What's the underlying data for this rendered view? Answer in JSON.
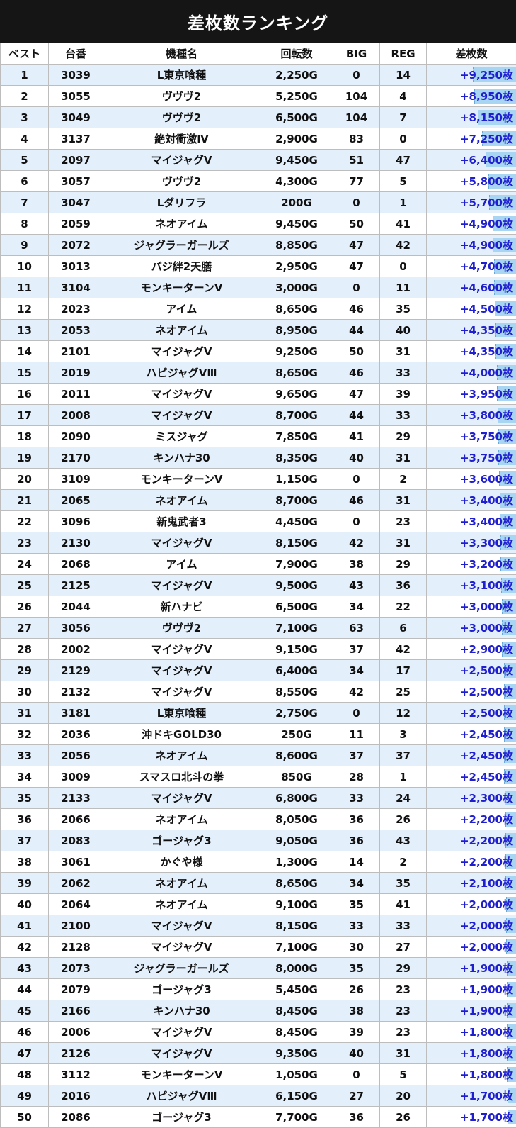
{
  "title": "差枚数ランキング",
  "columns": [
    "ベスト",
    "台番",
    "機種名",
    "回転数",
    "BIG",
    "REG",
    "差枚数"
  ],
  "colors": {
    "header_bg": "#151515",
    "row_alt": "#e3effb",
    "bar": "#a8d6f2",
    "diff_text": "#1f1fcf"
  },
  "chart_data": {
    "type": "table",
    "title": "差枚数ランキング",
    "columns": [
      "ベスト",
      "台番",
      "機種名",
      "回転数",
      "BIG",
      "REG",
      "差枚数"
    ],
    "bar_max": 9250,
    "rows": [
      {
        "rank": "1",
        "machine_no": "3039",
        "name": "L東京喰種",
        "spins": "2,250G",
        "big": "0",
        "reg": "14",
        "diff": "+9,250枚",
        "diff_value": 9250
      },
      {
        "rank": "2",
        "machine_no": "3055",
        "name": "ヴヴヴ2",
        "spins": "5,250G",
        "big": "104",
        "reg": "4",
        "diff": "+8,950枚",
        "diff_value": 8950
      },
      {
        "rank": "3",
        "machine_no": "3049",
        "name": "ヴヴヴ2",
        "spins": "6,500G",
        "big": "104",
        "reg": "7",
        "diff": "+8,150枚",
        "diff_value": 8150
      },
      {
        "rank": "4",
        "machine_no": "3137",
        "name": "絶対衝激Ⅳ",
        "spins": "2,900G",
        "big": "83",
        "reg": "0",
        "diff": "+7,250枚",
        "diff_value": 7250
      },
      {
        "rank": "5",
        "machine_no": "2097",
        "name": "マイジャグV",
        "spins": "9,450G",
        "big": "51",
        "reg": "47",
        "diff": "+6,400枚",
        "diff_value": 6400
      },
      {
        "rank": "6",
        "machine_no": "3057",
        "name": "ヴヴヴ2",
        "spins": "4,300G",
        "big": "77",
        "reg": "5",
        "diff": "+5,800枚",
        "diff_value": 5800
      },
      {
        "rank": "7",
        "machine_no": "3047",
        "name": "Lダリフラ",
        "spins": "200G",
        "big": "0",
        "reg": "1",
        "diff": "+5,700枚",
        "diff_value": 5700
      },
      {
        "rank": "8",
        "machine_no": "2059",
        "name": "ネオアイム",
        "spins": "9,450G",
        "big": "50",
        "reg": "41",
        "diff": "+4,900枚",
        "diff_value": 4900
      },
      {
        "rank": "9",
        "machine_no": "2072",
        "name": "ジャグラーガールズ",
        "spins": "8,850G",
        "big": "47",
        "reg": "42",
        "diff": "+4,900枚",
        "diff_value": 4900
      },
      {
        "rank": "10",
        "machine_no": "3013",
        "name": "バジ絆2天膳",
        "spins": "2,950G",
        "big": "47",
        "reg": "0",
        "diff": "+4,700枚",
        "diff_value": 4700
      },
      {
        "rank": "11",
        "machine_no": "3104",
        "name": "モンキーターンV",
        "spins": "3,000G",
        "big": "0",
        "reg": "11",
        "diff": "+4,600枚",
        "diff_value": 4600
      },
      {
        "rank": "12",
        "machine_no": "2023",
        "name": "アイム",
        "spins": "8,650G",
        "big": "46",
        "reg": "35",
        "diff": "+4,500枚",
        "diff_value": 4500
      },
      {
        "rank": "13",
        "machine_no": "2053",
        "name": "ネオアイム",
        "spins": "8,950G",
        "big": "44",
        "reg": "40",
        "diff": "+4,350枚",
        "diff_value": 4350
      },
      {
        "rank": "14",
        "machine_no": "2101",
        "name": "マイジャグV",
        "spins": "9,250G",
        "big": "50",
        "reg": "31",
        "diff": "+4,350枚",
        "diff_value": 4350
      },
      {
        "rank": "15",
        "machine_no": "2019",
        "name": "ハピジャグVⅢ",
        "spins": "8,650G",
        "big": "46",
        "reg": "33",
        "diff": "+4,000枚",
        "diff_value": 4000
      },
      {
        "rank": "16",
        "machine_no": "2011",
        "name": "マイジャグV",
        "spins": "9,650G",
        "big": "47",
        "reg": "39",
        "diff": "+3,950枚",
        "diff_value": 3950
      },
      {
        "rank": "17",
        "machine_no": "2008",
        "name": "マイジャグV",
        "spins": "8,700G",
        "big": "44",
        "reg": "33",
        "diff": "+3,800枚",
        "diff_value": 3800
      },
      {
        "rank": "18",
        "machine_no": "2090",
        "name": "ミスジャグ",
        "spins": "7,850G",
        "big": "41",
        "reg": "29",
        "diff": "+3,750枚",
        "diff_value": 3750
      },
      {
        "rank": "19",
        "machine_no": "2170",
        "name": "キンハナ30",
        "spins": "8,350G",
        "big": "40",
        "reg": "31",
        "diff": "+3,750枚",
        "diff_value": 3750
      },
      {
        "rank": "20",
        "machine_no": "3109",
        "name": "モンキーターンV",
        "spins": "1,150G",
        "big": "0",
        "reg": "2",
        "diff": "+3,600枚",
        "diff_value": 3600
      },
      {
        "rank": "21",
        "machine_no": "2065",
        "name": "ネオアイム",
        "spins": "8,700G",
        "big": "46",
        "reg": "31",
        "diff": "+3,400枚",
        "diff_value": 3400
      },
      {
        "rank": "22",
        "machine_no": "3096",
        "name": "新鬼武者3",
        "spins": "4,450G",
        "big": "0",
        "reg": "23",
        "diff": "+3,400枚",
        "diff_value": 3400
      },
      {
        "rank": "23",
        "machine_no": "2130",
        "name": "マイジャグV",
        "spins": "8,150G",
        "big": "42",
        "reg": "31",
        "diff": "+3,300枚",
        "diff_value": 3300
      },
      {
        "rank": "24",
        "machine_no": "2068",
        "name": "アイム",
        "spins": "7,900G",
        "big": "38",
        "reg": "29",
        "diff": "+3,200枚",
        "diff_value": 3200
      },
      {
        "rank": "25",
        "machine_no": "2125",
        "name": "マイジャグV",
        "spins": "9,500G",
        "big": "43",
        "reg": "36",
        "diff": "+3,100枚",
        "diff_value": 3100
      },
      {
        "rank": "26",
        "machine_no": "2044",
        "name": "新ハナビ",
        "spins": "6,500G",
        "big": "34",
        "reg": "22",
        "diff": "+3,000枚",
        "diff_value": 3000
      },
      {
        "rank": "27",
        "machine_no": "3056",
        "name": "ヴヴヴ2",
        "spins": "7,100G",
        "big": "63",
        "reg": "6",
        "diff": "+3,000枚",
        "diff_value": 3000
      },
      {
        "rank": "28",
        "machine_no": "2002",
        "name": "マイジャグV",
        "spins": "9,150G",
        "big": "37",
        "reg": "42",
        "diff": "+2,900枚",
        "diff_value": 2900
      },
      {
        "rank": "29",
        "machine_no": "2129",
        "name": "マイジャグV",
        "spins": "6,400G",
        "big": "34",
        "reg": "17",
        "diff": "+2,500枚",
        "diff_value": 2500
      },
      {
        "rank": "30",
        "machine_no": "2132",
        "name": "マイジャグV",
        "spins": "8,550G",
        "big": "42",
        "reg": "25",
        "diff": "+2,500枚",
        "diff_value": 2500
      },
      {
        "rank": "31",
        "machine_no": "3181",
        "name": "L東京喰種",
        "spins": "2,750G",
        "big": "0",
        "reg": "12",
        "diff": "+2,500枚",
        "diff_value": 2500
      },
      {
        "rank": "32",
        "machine_no": "2036",
        "name": "沖ドキGOLD30",
        "spins": "250G",
        "big": "11",
        "reg": "3",
        "diff": "+2,450枚",
        "diff_value": 2450
      },
      {
        "rank": "33",
        "machine_no": "2056",
        "name": "ネオアイム",
        "spins": "8,600G",
        "big": "37",
        "reg": "37",
        "diff": "+2,450枚",
        "diff_value": 2450
      },
      {
        "rank": "34",
        "machine_no": "3009",
        "name": "スマスロ北斗の拳",
        "spins": "850G",
        "big": "28",
        "reg": "1",
        "diff": "+2,450枚",
        "diff_value": 2450
      },
      {
        "rank": "35",
        "machine_no": "2133",
        "name": "マイジャグV",
        "spins": "6,800G",
        "big": "33",
        "reg": "24",
        "diff": "+2,300枚",
        "diff_value": 2300
      },
      {
        "rank": "36",
        "machine_no": "2066",
        "name": "ネオアイム",
        "spins": "8,050G",
        "big": "36",
        "reg": "26",
        "diff": "+2,200枚",
        "diff_value": 2200
      },
      {
        "rank": "37",
        "machine_no": "2083",
        "name": "ゴージャグ3",
        "spins": "9,050G",
        "big": "36",
        "reg": "43",
        "diff": "+2,200枚",
        "diff_value": 2200
      },
      {
        "rank": "38",
        "machine_no": "3061",
        "name": "かぐや様",
        "spins": "1,300G",
        "big": "14",
        "reg": "2",
        "diff": "+2,200枚",
        "diff_value": 2200
      },
      {
        "rank": "39",
        "machine_no": "2062",
        "name": "ネオアイム",
        "spins": "8,650G",
        "big": "34",
        "reg": "35",
        "diff": "+2,100枚",
        "diff_value": 2100
      },
      {
        "rank": "40",
        "machine_no": "2064",
        "name": "ネオアイム",
        "spins": "9,100G",
        "big": "35",
        "reg": "41",
        "diff": "+2,000枚",
        "diff_value": 2000
      },
      {
        "rank": "41",
        "machine_no": "2100",
        "name": "マイジャグV",
        "spins": "8,150G",
        "big": "33",
        "reg": "33",
        "diff": "+2,000枚",
        "diff_value": 2000
      },
      {
        "rank": "42",
        "machine_no": "2128",
        "name": "マイジャグV",
        "spins": "7,100G",
        "big": "30",
        "reg": "27",
        "diff": "+2,000枚",
        "diff_value": 2000
      },
      {
        "rank": "43",
        "machine_no": "2073",
        "name": "ジャグラーガールズ",
        "spins": "8,000G",
        "big": "35",
        "reg": "29",
        "diff": "+1,900枚",
        "diff_value": 1900
      },
      {
        "rank": "44",
        "machine_no": "2079",
        "name": "ゴージャグ3",
        "spins": "5,450G",
        "big": "26",
        "reg": "23",
        "diff": "+1,900枚",
        "diff_value": 1900
      },
      {
        "rank": "45",
        "machine_no": "2166",
        "name": "キンハナ30",
        "spins": "8,450G",
        "big": "38",
        "reg": "23",
        "diff": "+1,900枚",
        "diff_value": 1900
      },
      {
        "rank": "46",
        "machine_no": "2006",
        "name": "マイジャグV",
        "spins": "8,450G",
        "big": "39",
        "reg": "23",
        "diff": "+1,800枚",
        "diff_value": 1800
      },
      {
        "rank": "47",
        "machine_no": "2126",
        "name": "マイジャグV",
        "spins": "9,350G",
        "big": "40",
        "reg": "31",
        "diff": "+1,800枚",
        "diff_value": 1800
      },
      {
        "rank": "48",
        "machine_no": "3112",
        "name": "モンキーターンV",
        "spins": "1,050G",
        "big": "0",
        "reg": "5",
        "diff": "+1,800枚",
        "diff_value": 1800
      },
      {
        "rank": "49",
        "machine_no": "2016",
        "name": "ハピジャグVⅢ",
        "spins": "6,150G",
        "big": "27",
        "reg": "20",
        "diff": "+1,700枚",
        "diff_value": 1700
      },
      {
        "rank": "50",
        "machine_no": "2086",
        "name": "ゴージャグ3",
        "spins": "7,700G",
        "big": "36",
        "reg": "26",
        "diff": "+1,700枚",
        "diff_value": 1700
      }
    ]
  }
}
